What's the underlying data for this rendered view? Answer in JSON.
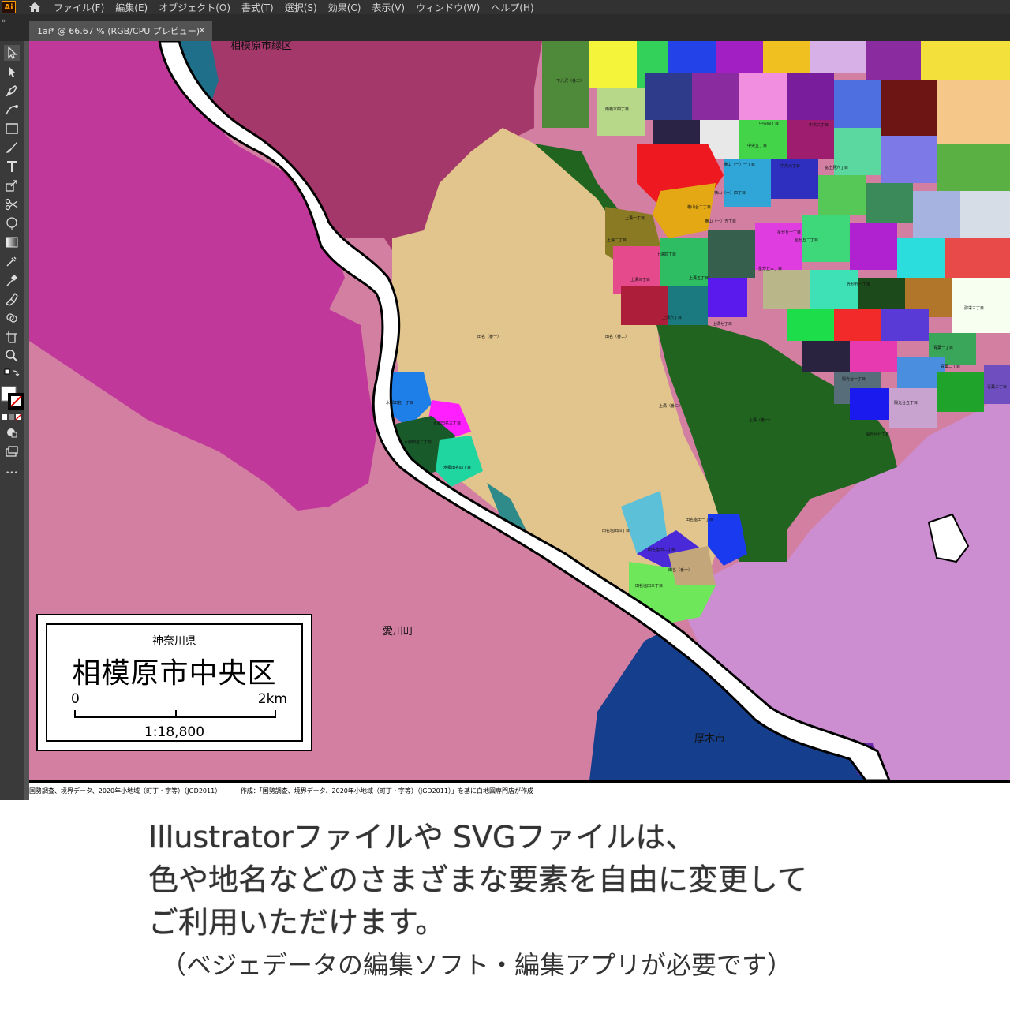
{
  "app": {
    "logo": "Ai",
    "menu": [
      "ファイル(F)",
      "編集(E)",
      "オブジェクト(O)",
      "書式(T)",
      "選択(S)",
      "効果(C)",
      "表示(V)",
      "ウィンドウ(W)",
      "ヘルプ(H)"
    ],
    "tab_title": "1ai* @ 66.67 % (RGB/CPU プレビュー)",
    "tab_close": "×",
    "toolbar_more": "•••"
  },
  "map": {
    "labels": {
      "midori": "相模原市緑区",
      "aikawa": "愛川町",
      "atsugi": "厚木市",
      "tana1": "田名（番一）",
      "kamimizo2": "上溝（番二）",
      "kamimizo1": "上溝（番一）",
      "tana2": "田名（番二）",
      "shimokuzawa": "下九沢（番二）",
      "minamihashimoto": "南橋本四丁目",
      "mizugo1": "水郷田名一丁目",
      "mizugo2": "水郷田名二丁目",
      "mizugo3": "水郷田名三丁目",
      "mizugo4": "水郷田名四丁目",
      "tanashioda1": "田名塩田一丁目",
      "tanashioda2": "田名塩田二丁目",
      "tanashioda3": "田名塩田三丁目",
      "tanashiodah": "田名塩田四丁目",
      "tana3": "田名（番一）",
      "kamimizo_1": "上溝一丁目",
      "kamimizo_2": "上溝二丁目",
      "kamimizo_3": "上溝三丁目",
      "kamimizo_4": "上溝四丁目",
      "kamimizo_5": "上溝五丁目",
      "kamimizo_6": "上溝六丁目",
      "kamimizo_7": "上溝七丁目",
      "yokoyamadai2": "横山台二丁目",
      "yokoyama1": "横山（一）一丁目",
      "yokoyama4": "横山（一）四丁目",
      "yokoyama5": "横山（一）五丁目",
      "chuo3": "中央三丁目",
      "chuo4": "中央四丁目",
      "chuo5": "中央五丁目",
      "chuo6": "中央六丁目",
      "fujimi6": "富士見六丁目",
      "hoshigaoka1": "星が丘一丁目",
      "hoshigaoka2": "星が丘二丁目",
      "hoshigaoka3": "星が丘三丁目",
      "mitsugaoka": "光が丘一丁目",
      "yayoi3": "弥栄三丁目",
      "aoba1": "青葉一丁目",
      "aoba2": "青葉二丁目",
      "aoba3": "青葉三丁目",
      "yokodai": "陽光台一丁目",
      "yokodai7": "陽光台七丁目",
      "yokodai5": "陽光台五丁目"
    }
  },
  "legend": {
    "prefecture": "神奈川県",
    "ward": "相模原市中央区",
    "scale_start": "0",
    "scale_end": "2km",
    "ratio": "1:18,800"
  },
  "credits": {
    "source": "国勢調査、境界データ、2020年小地域（町丁・字等）（JGD2011）",
    "author": "作成：「国勢調査、境界データ、2020年小地域（町丁・字等）（JGD2011）」を基に白地図専門店が作成"
  },
  "caption": {
    "line1": "Illustratorファイルや SVGファイルは、",
    "line2": "色や地名などのさまざまな要素を自由に変更して",
    "line3": "ご利用いただけます。",
    "note": "（ベジェデータの編集ソフト・編集アプリが必要です）"
  },
  "colors": {
    "menubar": "#323232",
    "toolbar": "#3a3a3a",
    "river": "#ffffff",
    "midori": "#a5386a",
    "aikawa": "#d37fa2",
    "tana": "#e2c58c",
    "atsugi": "#153e8c",
    "green": "#206420"
  }
}
